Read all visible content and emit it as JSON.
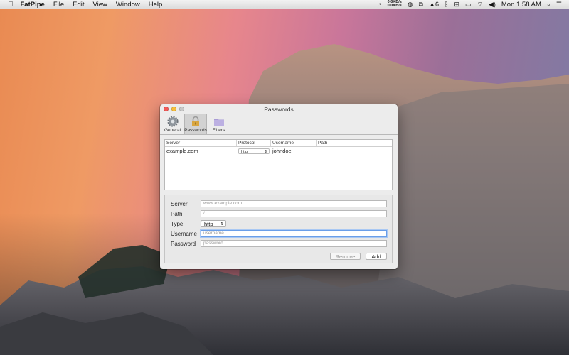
{
  "menubar": {
    "app_name": "FatPipe",
    "menus": [
      "File",
      "Edit",
      "View",
      "Window",
      "Help"
    ],
    "net_up": "0.0KB/s",
    "net_down": "0.0KB/s",
    "notification_count": "6",
    "clock": "Mon 1:58 AM"
  },
  "window": {
    "title": "Passwords",
    "toolbar": [
      {
        "label": "General",
        "icon": "gear-icon"
      },
      {
        "label": "Passwords",
        "icon": "lock-icon"
      },
      {
        "label": "Filters",
        "icon": "folder-icon"
      }
    ],
    "active_tab": "Passwords"
  },
  "table": {
    "columns": [
      "Server",
      "Protocol",
      "Username",
      "Path"
    ],
    "rows": [
      {
        "server": "example.com",
        "protocol": "http",
        "username": "johndoe",
        "path": ""
      }
    ]
  },
  "form": {
    "server_label": "Server",
    "server_placeholder": "www.example.com",
    "path_label": "Path",
    "path_placeholder": "/",
    "type_label": "Type",
    "type_value": "http",
    "username_label": "Username",
    "username_placeholder": "username",
    "password_label": "Password",
    "password_placeholder": "password",
    "remove_label": "Remove",
    "add_label": "Add"
  },
  "colors": {
    "focus_ring": "#6a9ee8",
    "close": "#f25a57",
    "minimize": "#f6bd3b"
  }
}
